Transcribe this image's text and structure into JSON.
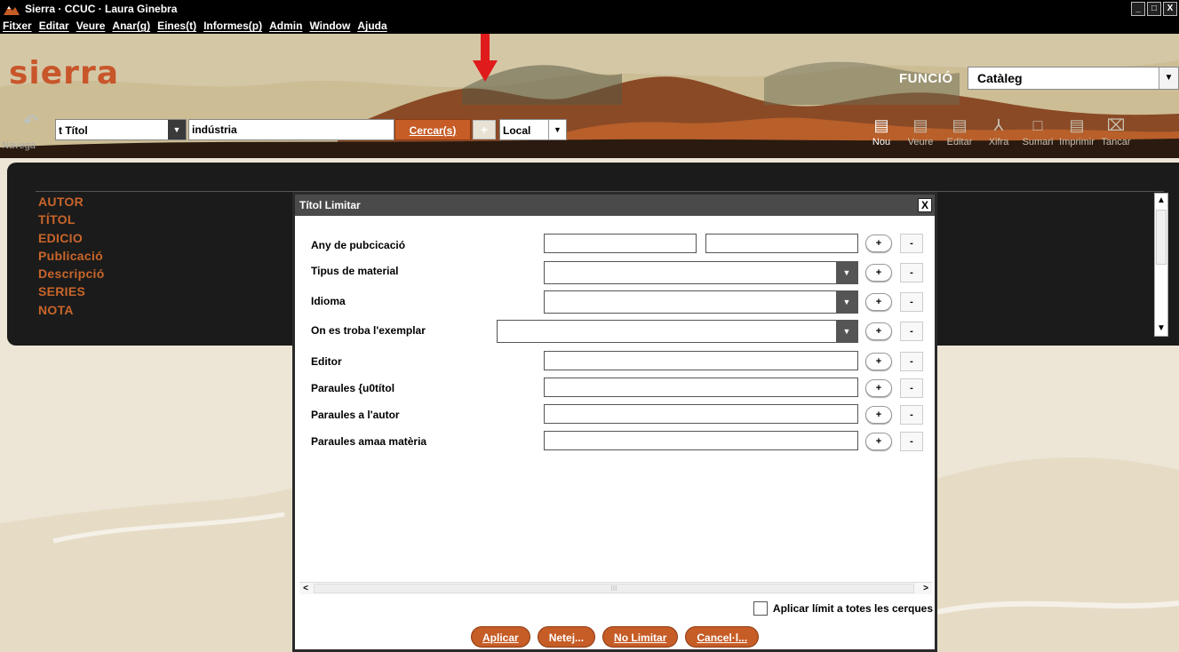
{
  "window": {
    "title": "Sierra · CCUC · Laura Ginebra",
    "controls": [
      "_",
      "□",
      "X"
    ]
  },
  "menu": [
    "Fitxer",
    "Editar",
    "Veure",
    "Anar(g)",
    "Eines(t)",
    "Informes(p)",
    "Admin",
    "Window",
    "Ajuda"
  ],
  "header": {
    "logo": "sierra",
    "funcio_label": "FUNCIÓ",
    "funcio_value": "Catàleg",
    "navega": "Navega"
  },
  "search": {
    "index": "t Títol",
    "query": "indústria",
    "button_prefix": "Cercar(",
    "button_key": "s",
    "button_suffix": ")",
    "plus": "+",
    "scope": "Local"
  },
  "toolbar": [
    {
      "label": "Nou",
      "icon": "new-record-icon"
    },
    {
      "label": "Veure",
      "icon": "view-icon"
    },
    {
      "label": "Editar",
      "icon": "edit-icon"
    },
    {
      "label": "Xifra",
      "icon": "tree-icon"
    },
    {
      "label": "Sumari",
      "icon": "summary-icon"
    },
    {
      "label": "Imprimir",
      "icon": "print-icon"
    },
    {
      "label": "Tancar",
      "icon": "close-record-icon"
    }
  ],
  "record_fields": [
    "AUTOR",
    "TÍTOL",
    "EDICIO",
    "Publicació",
    "Descripció",
    "SERIES",
    "NOTA"
  ],
  "dialog": {
    "title": "Títol Limitar",
    "close": "X",
    "rows": [
      {
        "label": "Any de pubcicació",
        "type": "range"
      },
      {
        "label": "Tipus de material",
        "type": "combo"
      },
      {
        "label": "Idioma",
        "type": "combo"
      },
      {
        "label": "On es troba l'exemplar",
        "type": "combo-wide"
      },
      {
        "label": "Editor",
        "type": "text"
      },
      {
        "label": "Paraules {u0títol",
        "type": "text"
      },
      {
        "label": "Paraules a l'autor",
        "type": "text"
      },
      {
        "label": "Paraules amaa matèria",
        "type": "text"
      }
    ],
    "plus_label": "+",
    "minus_label": "-",
    "scroll_grip": "III",
    "apply_all_label": "Aplicar límit a totes les cerques",
    "buttons": {
      "aplicar": "Aplicar",
      "netej": "Netej...",
      "no_limitar": "No Limitar",
      "cancel": "Cancel·l..."
    }
  },
  "colors": {
    "accent": "#c65c26",
    "field_text": "#c8652a",
    "panel": "#1b1b1b"
  }
}
